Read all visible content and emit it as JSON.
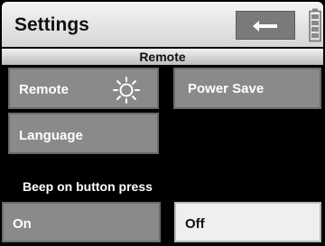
{
  "header": {
    "title": "Settings"
  },
  "section": {
    "title": "Remote"
  },
  "menu": {
    "remote_label": "Remote",
    "power_save_label": "Power Save",
    "language_label": "Language"
  },
  "beep": {
    "label": "Beep on button press",
    "on_label": "On",
    "off_label": "Off",
    "selected": "Off"
  },
  "icons": {
    "back": "return-arrow-icon",
    "battery": "battery-icon",
    "remote": "sun-icon"
  },
  "colors": {
    "button_gray": "#8a8a8a",
    "selected_bg": "#efefef",
    "background": "#000000"
  }
}
